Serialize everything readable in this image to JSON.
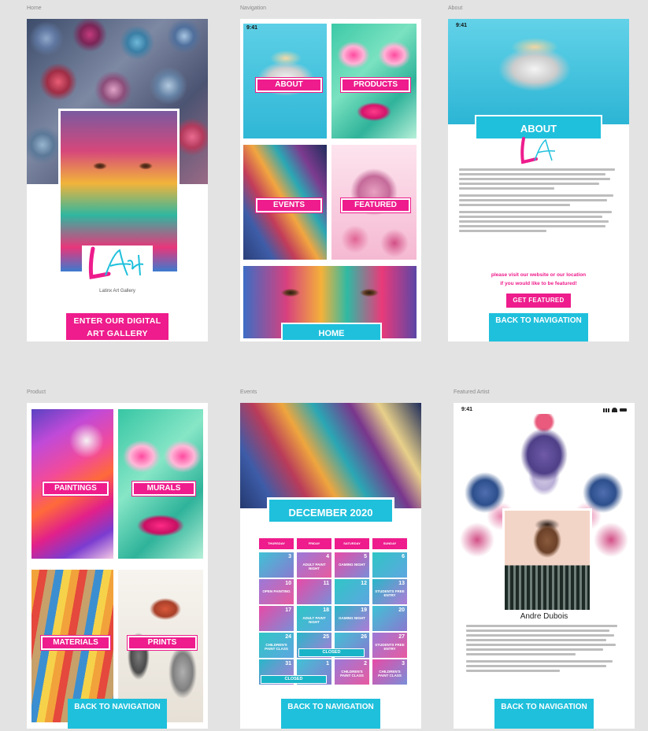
{
  "boards": {
    "home": "Home",
    "navigation": "Navigation",
    "about": "About",
    "product": "Product",
    "events": "Events",
    "featured": "Featured Artist"
  },
  "status_time": "9:41",
  "logo": {
    "tagline": "Latinx Art Gallery"
  },
  "home": {
    "enter_button": "ENTER OUR DIGITAL ART GALLERY"
  },
  "navigation": {
    "about": "ABOUT",
    "products": "PRODUCTS",
    "events": "EVENTS",
    "featured": "FEATURED",
    "home": "HOME"
  },
  "about": {
    "title": "ABOUT",
    "callout_line1": "please visit our website or our location",
    "callout_line2": "if you would like to be featured!",
    "get_featured": "GET FEATURED",
    "back": "BACK TO NAVIGATION"
  },
  "product": {
    "paintings": "PAINTINGS",
    "murals": "MURALS",
    "materials": "MATERIALS",
    "prints": "PRINTS",
    "back": "BACK TO NAVIGATION"
  },
  "events": {
    "month": "DECEMBER 2020",
    "weekdays": [
      "THURSDAY",
      "FRIDAY",
      "SATURDAY",
      "SUNDAY"
    ],
    "cells": [
      {
        "day": "3",
        "event": ""
      },
      {
        "day": "4",
        "event": "ADULT PAINT NIGHT"
      },
      {
        "day": "5",
        "event": "GAMING NIGHT"
      },
      {
        "day": "6",
        "event": ""
      },
      {
        "day": "10",
        "event": "OPEN PAINTING"
      },
      {
        "day": "11",
        "event": ""
      },
      {
        "day": "12",
        "event": ""
      },
      {
        "day": "13",
        "event": "STUDENTS FREE ENTRY"
      },
      {
        "day": "17",
        "event": ""
      },
      {
        "day": "18",
        "event": "ADULT PAINT NIGHT"
      },
      {
        "day": "19",
        "event": "GAMING NIGHT"
      },
      {
        "day": "20",
        "event": ""
      },
      {
        "day": "24",
        "event": "CHILDREN'S PAINT CLASS"
      },
      {
        "day": "25",
        "event": ""
      },
      {
        "day": "26",
        "event": ""
      },
      {
        "day": "27",
        "event": "STUDENTS FREE ENTRY"
      },
      {
        "day": "31",
        "event": ""
      },
      {
        "day": "1",
        "event": ""
      },
      {
        "day": "2",
        "event": "CHILDREN'S PAINT CLASS"
      },
      {
        "day": "3",
        "event": "CHILDREN'S PAINT CLASS"
      }
    ],
    "closed": "CLOSED",
    "back": "BACK TO NAVIGATION"
  },
  "featured": {
    "artist_name": "Andre Dubois",
    "back": "BACK TO NAVIGATION"
  },
  "colors": {
    "pink": "#ee1c8c",
    "cyan": "#1fc0dc"
  }
}
